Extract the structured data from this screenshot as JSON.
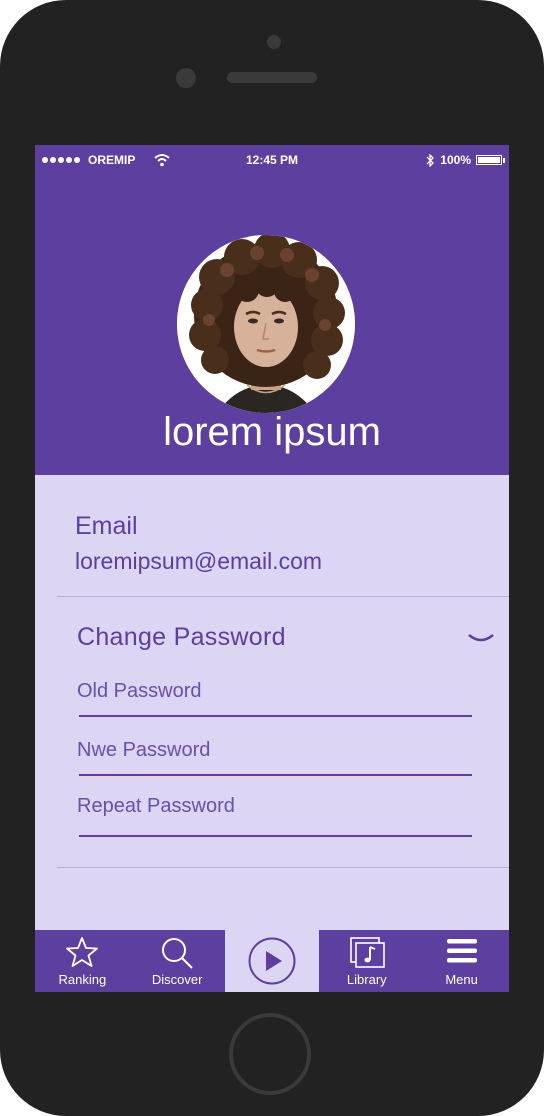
{
  "status_bar": {
    "carrier": "OREMIP",
    "time": "12:45 PM",
    "battery": "100%"
  },
  "profile": {
    "name": "lorem ipsum"
  },
  "account": {
    "email_label": "Email",
    "email_value": "loremipsum@email.com"
  },
  "password_section": {
    "title": "Change Password",
    "fields": {
      "old": "Old Password",
      "new": "Nwe Password",
      "repeat": "Repeat Password"
    }
  },
  "tabbar": {
    "items": [
      {
        "label": "Ranking",
        "icon": "star-icon"
      },
      {
        "label": "Discover",
        "icon": "search-icon"
      },
      {
        "label": "",
        "icon": "play-icon",
        "active": true
      },
      {
        "label": "Library",
        "icon": "music-library-icon"
      },
      {
        "label": "Menu",
        "icon": "menu-icon"
      }
    ]
  },
  "colors": {
    "primary": "#5c3f9e",
    "light": "#dcd5f3",
    "phone": "#222222"
  }
}
